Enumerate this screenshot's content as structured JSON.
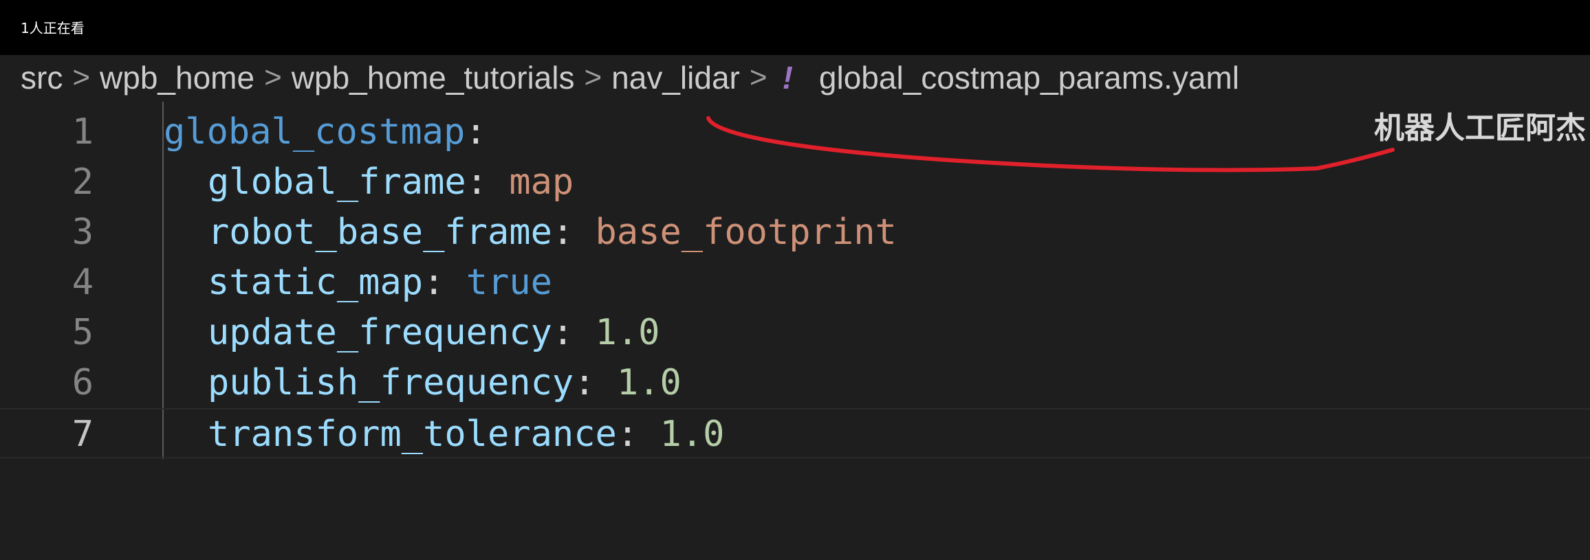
{
  "overlay": {
    "viewers_text": "1人正在看",
    "watermark": "机器人工匠阿杰",
    "annotation_color": "#e0202a"
  },
  "breadcrumb": {
    "items": [
      "src",
      "wpb_home",
      "wpb_home_tutorials",
      "nav_lidar"
    ],
    "file_icon": "!",
    "file_name": "global_costmap_params.yaml",
    "separator": ">"
  },
  "editor": {
    "lines": [
      {
        "number": "1",
        "key": "global_costmap",
        "colon": ":",
        "value": "",
        "value_type": "none"
      },
      {
        "number": "2",
        "key": "global_frame",
        "colon": ":",
        "value": "map",
        "value_type": "string"
      },
      {
        "number": "3",
        "key": "robot_base_frame",
        "colon": ":",
        "value": "base_footprint",
        "value_type": "string"
      },
      {
        "number": "4",
        "key": "static_map",
        "colon": ":",
        "value": "true",
        "value_type": "boolean"
      },
      {
        "number": "5",
        "key": "update_frequency",
        "colon": ":",
        "value": "1.0",
        "value_type": "number"
      },
      {
        "number": "6",
        "key": "publish_frequency",
        "colon": ":",
        "value": "1.0",
        "value_type": "number"
      },
      {
        "number": "7",
        "key": "transform_tolerance",
        "colon": ":",
        "value": "1.0",
        "value_type": "number"
      }
    ],
    "current_line": "7"
  }
}
